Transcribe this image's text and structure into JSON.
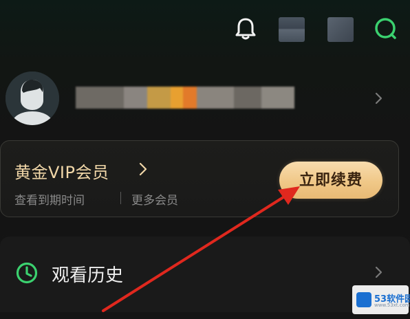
{
  "header": {
    "icons": [
      "bell-icon",
      "placeholder-icon",
      "placeholder-icon",
      "search-icon"
    ]
  },
  "profile": {
    "name_blurred": true
  },
  "vip": {
    "title": "黄金VIP会员",
    "sub_left": "查看到期时间",
    "sub_right": "更多会员",
    "renew_label": "立即续费"
  },
  "menu": {
    "history_label": "观看历史"
  },
  "colors": {
    "accent_green": "#3bd16f",
    "gold_text": "#f1d7a8",
    "button_gold": "#f0c888",
    "arrow_red": "#e0281e"
  },
  "watermark": {
    "brand": "53软件园",
    "url": "www.53xt.com"
  }
}
